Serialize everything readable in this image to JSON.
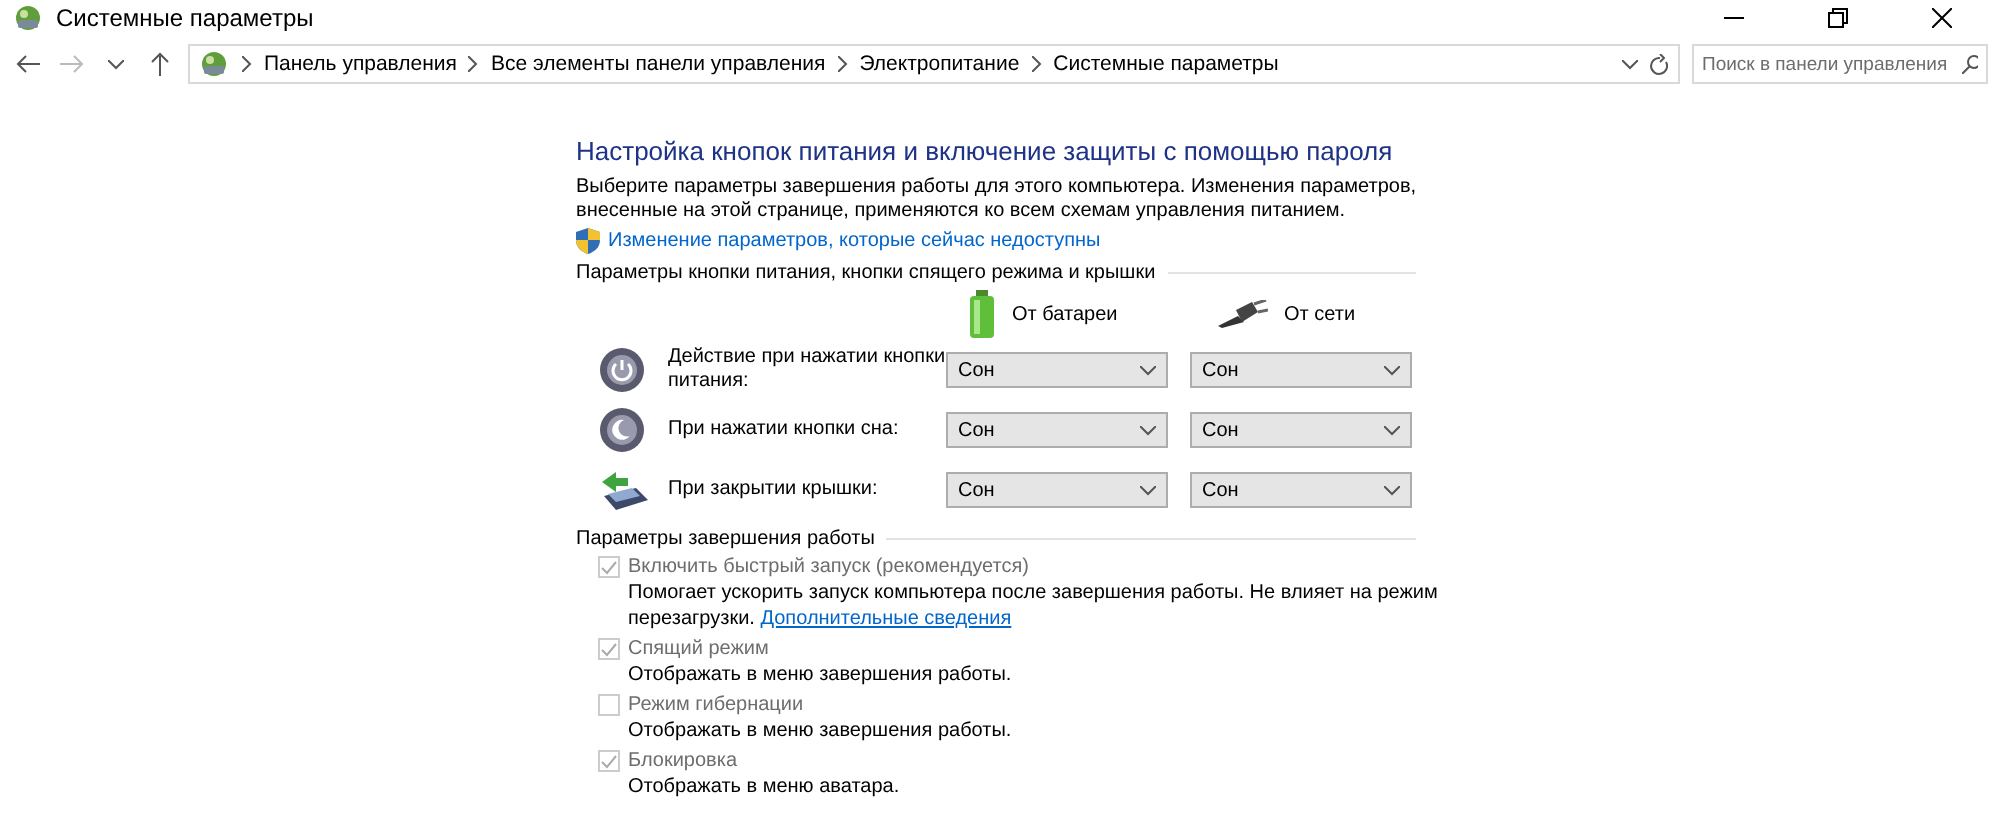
{
  "window": {
    "title": "Системные параметры"
  },
  "breadcrumb": [
    "Панель управления",
    "Все элементы панели управления",
    "Электропитание",
    "Системные параметры"
  ],
  "search": {
    "placeholder": "Поиск в панели управления"
  },
  "heading": "Настройка кнопок питания и включение защиты с помощью пароля",
  "intro": "Выберите параметры завершения работы для этого компьютера. Изменения параметров, внесенные на этой странице, применяются ко всем схемам управления питанием.",
  "admin_link": "Изменение параметров, которые сейчас недоступны",
  "buttons_section": {
    "title": "Параметры кнопки питания, кнопки спящего режима и крышки",
    "columns": [
      {
        "kind": "battery",
        "label": "От батареи"
      },
      {
        "kind": "plug",
        "label": "От сети"
      }
    ],
    "rows": [
      {
        "kind": "power",
        "label": "Действие при нажатии кнопки питания:",
        "values": [
          "Сон",
          "Сон"
        ]
      },
      {
        "kind": "sleep",
        "label": "При нажатии кнопки сна:",
        "values": [
          "Сон",
          "Сон"
        ]
      },
      {
        "kind": "lid",
        "label": "При закрытии крышки:",
        "values": [
          "Сон",
          "Сон"
        ]
      }
    ]
  },
  "shutdown_section": {
    "title": "Параметры завершения работы",
    "options": [
      {
        "label": "Включить быстрый запуск (рекомендуется)",
        "checked": true,
        "disabled": true,
        "description": "Помогает ускорить запуск компьютера после завершения работы. Не влияет на режим перезагрузки.",
        "link": "Дополнительные сведения"
      },
      {
        "label": "Спящий режим",
        "checked": true,
        "disabled": true,
        "description": "Отображать в меню завершения работы."
      },
      {
        "label": "Режим гибернации",
        "checked": false,
        "disabled": true,
        "description": "Отображать в меню завершения работы."
      },
      {
        "label": "Блокировка",
        "checked": true,
        "disabled": true,
        "description": "Отображать в меню аватара."
      }
    ]
  }
}
